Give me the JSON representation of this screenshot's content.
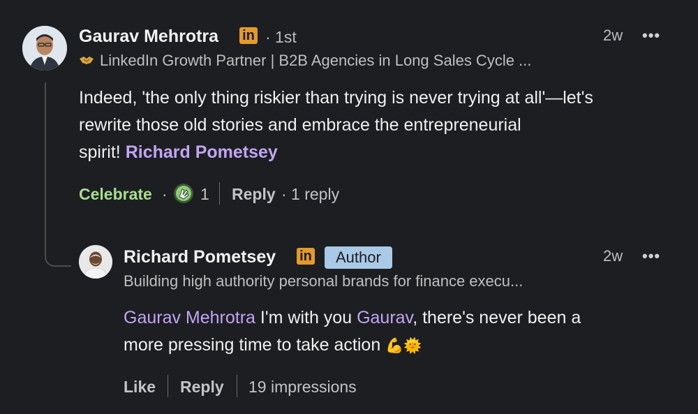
{
  "comment": {
    "author_name": "Gaurav Mehrotra",
    "linkedin_badge": "in",
    "degree": "· 1st",
    "headline_icon": "handshake-icon",
    "headline": "LinkedIn Growth Partner | B2B Agencies in Long Sales Cycle ...",
    "time": "2w",
    "more": "•••",
    "text_line1": "Indeed, 'the only thing riskier than trying is never trying at all'—let's",
    "text_line2": "rewrite those old stories and embrace the entrepreneurial",
    "text_line3_prefix": "spirit! ",
    "mention": "Richard Pometsey",
    "celebrate_label": "Celebrate",
    "dot": "·",
    "reaction_icon": "clapping-hands-icon",
    "reaction_count": "1",
    "reply_label": "Reply",
    "replies": "· 1 reply"
  },
  "reply": {
    "author_name": "Richard Pometsey",
    "linkedin_badge": "in",
    "author_badge": "Author",
    "headline": "Building high authority personal brands for finance execu...",
    "time": "2w",
    "more": "•••",
    "mention1": "Gaurav Mehrotra",
    "text_a": " I'm with you ",
    "mention2": "Gaurav",
    "text_b": ", there's never been a",
    "text_line2": "more pressing time to take action ",
    "emoji": "💪🌞",
    "like_label": "Like",
    "reply_label": "Reply",
    "impressions": "19 impressions"
  },
  "colors": {
    "background": "#1c1e21",
    "mention": "#c3a4f4",
    "celebrate": "#a7de8f",
    "linkedin_badge": "#e49a2b",
    "author_badge": "#a9c9e7"
  }
}
